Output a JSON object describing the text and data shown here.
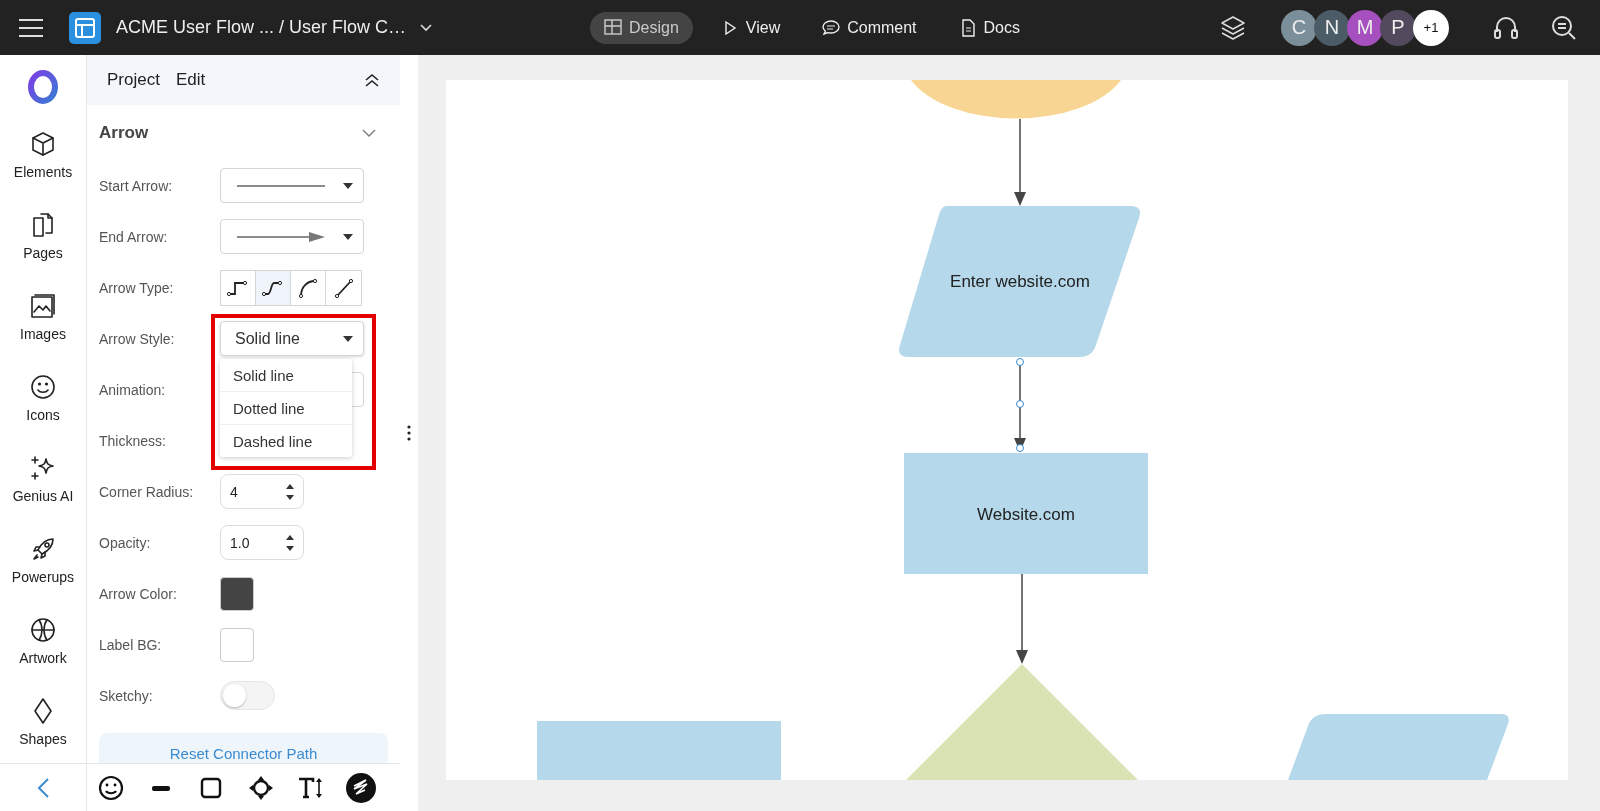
{
  "topbar": {
    "title": "ACME User Flow ... / User Flow C…",
    "modes": [
      {
        "label": "Design",
        "kind": "design",
        "selected": true
      },
      {
        "label": "View",
        "kind": "view",
        "selected": false
      },
      {
        "label": "Comment",
        "kind": "comment",
        "selected": false
      },
      {
        "label": "Docs",
        "kind": "docs",
        "selected": false
      }
    ],
    "avatars": [
      {
        "initial": "C",
        "color": "#7b8f9a"
      },
      {
        "initial": "N",
        "color": "#4b5c66"
      },
      {
        "initial": "M",
        "color": "#a64fbf"
      },
      {
        "initial": "P",
        "color": "#524a5c"
      },
      {
        "initial": "+1",
        "color": "#ffffff"
      }
    ]
  },
  "rail": {
    "items": [
      {
        "label": "Elements",
        "kind": "cube"
      },
      {
        "label": "Pages",
        "kind": "pages"
      },
      {
        "label": "Images",
        "kind": "image"
      },
      {
        "label": "Icons",
        "kind": "smiley"
      },
      {
        "label": "Genius AI",
        "kind": "sparkle"
      },
      {
        "label": "Powerups",
        "kind": "rocket"
      },
      {
        "label": "Artwork",
        "kind": "ball"
      },
      {
        "label": "Shapes",
        "kind": "diamond"
      }
    ]
  },
  "panel": {
    "tabs": [
      "Project",
      "Edit"
    ],
    "section": {
      "title": "Arrow",
      "expanded": true
    },
    "fields": [
      {
        "label": "Start Arrow:",
        "kind": "line-select",
        "arrowhead": false
      },
      {
        "label": "End Arrow:",
        "kind": "line-select",
        "arrowhead": true
      },
      {
        "label": "Arrow Type:",
        "kind": "segmented",
        "options": [
          {
            "kind": "step",
            "selected": false
          },
          {
            "kind": "s-curve",
            "selected": true
          },
          {
            "kind": "arc",
            "selected": false
          },
          {
            "kind": "straight",
            "selected": false
          }
        ]
      },
      {
        "label": "Arrow Style:",
        "kind": "select",
        "value": "Solid line",
        "highlighted": true,
        "open": true,
        "options": [
          "Solid line",
          "Dotted line",
          "Dashed line"
        ]
      },
      {
        "label": "Animation:",
        "kind": "select"
      },
      {
        "label": "Thickness:",
        "kind": "hidden"
      },
      {
        "label": "Corner Radius:",
        "kind": "number",
        "value": "4"
      },
      {
        "label": "Opacity:",
        "kind": "number",
        "value": "1.0"
      },
      {
        "label": "Arrow Color:",
        "kind": "color",
        "color": "#444444"
      },
      {
        "label": "Label BG:",
        "kind": "color",
        "color": "#ffffff"
      },
      {
        "label": "Sketchy:",
        "kind": "toggle",
        "on": false
      }
    ],
    "reset_button": "Reset Connector Path"
  },
  "toolbar": {
    "tools": [
      {
        "kind": "smiley"
      },
      {
        "kind": "line"
      },
      {
        "kind": "square"
      },
      {
        "kind": "move"
      },
      {
        "kind": "text"
      },
      {
        "kind": "scribble"
      }
    ]
  },
  "canvas": {
    "shapes": [
      {
        "kind": "ellipse",
        "color": "#f8d592"
      },
      {
        "kind": "parallelogram",
        "color": "#b5d8ea",
        "label": "Enter website.com"
      },
      {
        "kind": "rectangle",
        "color": "#b5d8ea",
        "label": "Website.com"
      },
      {
        "kind": "diamond",
        "color": "#d9e3b4"
      },
      {
        "kind": "rectangle-low",
        "color": "#b5d8ea"
      },
      {
        "kind": "parallelogram-low",
        "color": "#b5d8ea"
      }
    ]
  }
}
